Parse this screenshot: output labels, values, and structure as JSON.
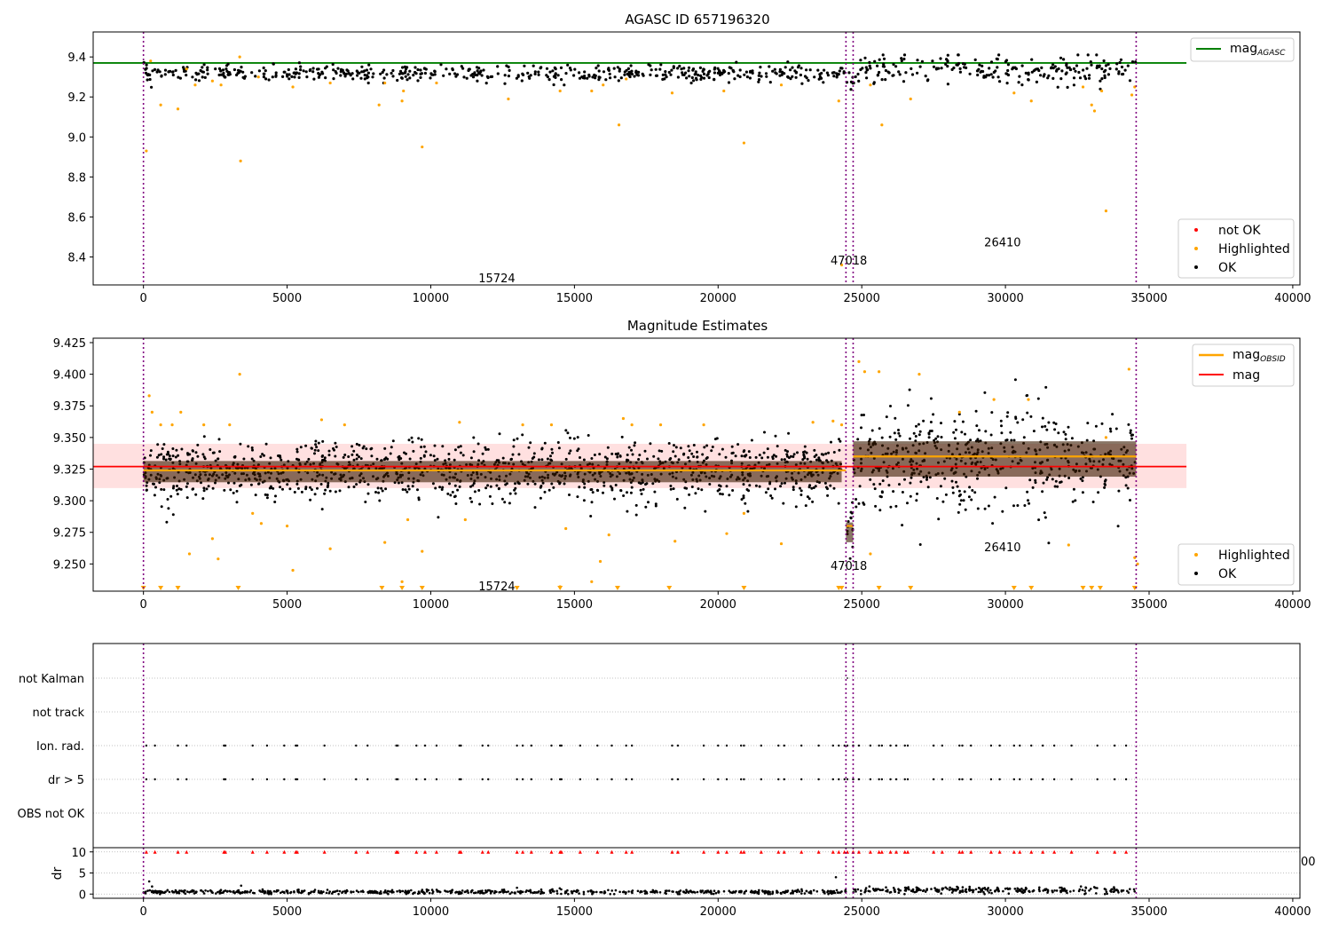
{
  "chart_data": [
    {
      "type": "scatter",
      "title": "AGASC ID 657196320",
      "xlim": [
        -1750,
        40250
      ],
      "ylim": [
        8.26,
        9.525
      ],
      "xticks": [
        0,
        5000,
        10000,
        15000,
        20000,
        25000,
        30000,
        35000,
        40000
      ],
      "xtick_labels": [
        "0",
        "5000",
        "10000",
        "15000",
        "20000",
        "25000",
        "30000",
        "35000",
        "40000"
      ],
      "yticks": [
        8.4,
        8.6,
        8.8,
        9.0,
        9.2,
        9.4
      ],
      "ytick_labels": [
        "8.4",
        "8.6",
        "8.8",
        "9.0",
        "9.2",
        "9.4"
      ],
      "vlines": [
        0,
        24450,
        24700,
        34550
      ],
      "hline": {
        "name": "mag_AGASC",
        "y": 9.37,
        "x": [
          -1750,
          36300
        ],
        "color": "#008000"
      },
      "series": [
        {
          "name": "not OK",
          "color": "#ff0000",
          "points": []
        },
        {
          "name": "Highlighted",
          "color": "#ffa500",
          "points": [
            [
              100,
              8.93
            ],
            [
              250,
              9.38
            ],
            [
              600,
              9.16
            ],
            [
              1200,
              9.14
            ],
            [
              1500,
              9.34
            ],
            [
              1800,
              9.26
            ],
            [
              2400,
              9.28
            ],
            [
              2700,
              9.26
            ],
            [
              3350,
              9.4
            ],
            [
              3380,
              8.88
            ],
            [
              4000,
              9.3
            ],
            [
              5200,
              9.25
            ],
            [
              6500,
              9.27
            ],
            [
              8200,
              9.16
            ],
            [
              8400,
              9.27
            ],
            [
              9000,
              9.18
            ],
            [
              9050,
              9.23
            ],
            [
              9700,
              8.95
            ],
            [
              10200,
              9.27
            ],
            [
              12700,
              9.19
            ],
            [
              14500,
              9.23
            ],
            [
              15600,
              9.23
            ],
            [
              16000,
              9.26
            ],
            [
              16550,
              9.06
            ],
            [
              16800,
              9.29
            ],
            [
              18400,
              9.22
            ],
            [
              20200,
              9.23
            ],
            [
              20900,
              8.97
            ],
            [
              22200,
              9.26
            ],
            [
              24200,
              9.18
            ],
            [
              24300,
              8.36
            ],
            [
              25300,
              9.26
            ],
            [
              25700,
              9.06
            ],
            [
              26700,
              9.19
            ],
            [
              30300,
              9.22
            ],
            [
              30900,
              9.18
            ],
            [
              32700,
              9.25
            ],
            [
              33000,
              9.16
            ],
            [
              33100,
              9.13
            ],
            [
              33350,
              9.23
            ],
            [
              33500,
              8.63
            ],
            [
              34400,
              9.21
            ],
            [
              34500,
              9.25
            ]
          ]
        },
        {
          "name": "OK",
          "color": "#000000",
          "segments": [
            {
              "x": [
                0,
                24250
              ],
              "mean": 9.318,
              "spread": 0.05
            },
            {
              "x": [
                24250,
                24450
              ],
              "mean": 9.33,
              "spread": 0.06
            },
            {
              "x": [
                24450,
                24700
              ],
              "mean": 9.28,
              "spread": 0.07
            },
            {
              "x": [
                24700,
                34550
              ],
              "mean": 9.335,
              "spread": 0.09
            }
          ]
        }
      ],
      "obsid_labels": [
        {
          "x": 12300,
          "y": 8.29,
          "text": "15724"
        },
        {
          "x": 24550,
          "y": 8.38,
          "text": "47018"
        },
        {
          "x": 29900,
          "y": 8.47,
          "text": "26410"
        }
      ],
      "legend_upper": {
        "placement": "upper right",
        "items": [
          "mag_AGASC"
        ]
      },
      "legend_lower": {
        "placement": "lower right",
        "items": [
          "not OK",
          "Highlighted",
          "OK"
        ]
      }
    },
    {
      "type": "scatter",
      "title": "Magnitude Estimates",
      "xlim": [
        -1750,
        40250
      ],
      "ylim": [
        9.2285,
        9.4285
      ],
      "xticks": [
        0,
        5000,
        10000,
        15000,
        20000,
        25000,
        30000,
        35000,
        40000
      ],
      "xtick_labels": [
        "0",
        "5000",
        "10000",
        "15000",
        "20000",
        "25000",
        "30000",
        "35000",
        "40000"
      ],
      "yticks": [
        9.25,
        9.275,
        9.3,
        9.325,
        9.35,
        9.375,
        9.4,
        9.425
      ],
      "ytick_labels": [
        "9.250",
        "9.275",
        "9.300",
        "9.325",
        "9.350",
        "9.375",
        "9.400",
        "9.425"
      ],
      "vlines": [
        0,
        24450,
        24700,
        34550
      ],
      "mag_line": {
        "name": "mag",
        "y": 9.327,
        "band": [
          9.31,
          9.345
        ],
        "x": [
          -1750,
          36300
        ],
        "color": "#ff0000"
      },
      "obsid_mag_segments": [
        {
          "x": [
            0,
            24450
          ],
          "y": 9.324
        },
        {
          "x": [
            24450,
            24700
          ],
          "y": 9.28
        },
        {
          "x": [
            24700,
            34550
          ],
          "y": 9.335
        }
      ],
      "series": [
        {
          "name": "Highlighted",
          "color": "#ffa500",
          "points": [
            [
              200,
              9.383
            ],
            [
              300,
              9.37
            ],
            [
              600,
              9.36
            ],
            [
              1000,
              9.36
            ],
            [
              1300,
              9.37
            ],
            [
              1600,
              9.258
            ],
            [
              2100,
              9.36
            ],
            [
              2400,
              9.27
            ],
            [
              2600,
              9.254
            ],
            [
              3000,
              9.36
            ],
            [
              3350,
              9.4
            ],
            [
              3800,
              9.29
            ],
            [
              4100,
              9.282
            ],
            [
              5000,
              9.28
            ],
            [
              5200,
              9.245
            ],
            [
              6200,
              9.364
            ],
            [
              6500,
              9.262
            ],
            [
              7000,
              9.36
            ],
            [
              8400,
              9.267
            ],
            [
              9000,
              9.236
            ],
            [
              9200,
              9.285
            ],
            [
              9700,
              9.26
            ],
            [
              11000,
              9.362
            ],
            [
              11200,
              9.285
            ],
            [
              13200,
              9.36
            ],
            [
              14200,
              9.36
            ],
            [
              14500,
              9.232
            ],
            [
              14700,
              9.278
            ],
            [
              15600,
              9.236
            ],
            [
              15900,
              9.252
            ],
            [
              16200,
              9.273
            ],
            [
              16700,
              9.365
            ],
            [
              17000,
              9.36
            ],
            [
              18000,
              9.36
            ],
            [
              18500,
              9.268
            ],
            [
              19500,
              9.36
            ],
            [
              20300,
              9.274
            ],
            [
              20900,
              9.29
            ],
            [
              22200,
              9.266
            ],
            [
              23300,
              9.362
            ],
            [
              24000,
              9.363
            ],
            [
              24300,
              9.36
            ],
            [
              24900,
              9.41
            ],
            [
              25100,
              9.402
            ],
            [
              25300,
              9.258
            ],
            [
              25600,
              9.402
            ],
            [
              27000,
              9.4
            ],
            [
              28400,
              9.37
            ],
            [
              29600,
              9.38
            ],
            [
              30800,
              9.38
            ],
            [
              32200,
              9.265
            ],
            [
              33500,
              9.35
            ],
            [
              34300,
              9.404
            ],
            [
              34500,
              9.255
            ],
            [
              34600,
              9.25
            ]
          ]
        },
        {
          "name": "OK",
          "color": "#000000",
          "segments": [
            {
              "x": [
                0,
                24300
              ],
              "mean": 9.323,
              "spread": 0.03
            },
            {
              "x": [
                24450,
                24700
              ],
              "mean": 9.275,
              "spread": 0.028
            },
            {
              "x": [
                24700,
                34550
              ],
              "mean": 9.333,
              "spread": 0.05
            }
          ]
        }
      ],
      "offscale_markers_x": [
        0,
        600,
        1200,
        3300,
        8300,
        9000,
        9700,
        13000,
        14500,
        16500,
        18300,
        20900,
        24200,
        24300,
        25600,
        26700,
        30300,
        30900,
        32700,
        33000,
        33300,
        34500
      ],
      "obsid_labels": [
        {
          "x": 12300,
          "y": 9.232,
          "text": "15724"
        },
        {
          "x": 24550,
          "y": 9.248,
          "text": "47018"
        },
        {
          "x": 29900,
          "y": 9.263,
          "text": "26410"
        }
      ],
      "legend_upper": {
        "placement": "upper right",
        "items": [
          "mag_OBSID",
          "mag"
        ]
      },
      "legend_lower": {
        "placement": "lower right",
        "items": [
          "Highlighted",
          "OK"
        ]
      }
    },
    {
      "type": "scatter",
      "categories": [
        "not Kalman",
        "not track",
        "Ion. rad.",
        "dr > 5",
        "OBS not OK"
      ],
      "xlim": [
        -1750,
        40250
      ],
      "vlines": [
        0,
        24450,
        24700,
        34550
      ],
      "flag_x_positions": [
        100,
        400,
        1200,
        1500,
        2800,
        2850,
        3800,
        4300,
        4900,
        5300,
        5350,
        6300,
        7400,
        7800,
        8800,
        8850,
        9500,
        9800,
        10200,
        11000,
        11050,
        11800,
        12000,
        13000,
        13200,
        13500,
        14200,
        14500,
        14550,
        15200,
        15800,
        16300,
        16800,
        17000,
        18400,
        18600,
        19500,
        20000,
        20300,
        20800,
        20900,
        21500,
        22100,
        22300,
        22900,
        23500,
        24000,
        24200,
        24400,
        24500,
        24700,
        24900,
        25300,
        25600,
        25700,
        26000,
        26200,
        26500,
        26600,
        27500,
        27800,
        28400,
        28500,
        28800,
        29500,
        29800,
        30300,
        30500,
        30900,
        31300,
        31700,
        32300,
        33200,
        33800,
        34200
      ],
      "not_kalman_x": [
        24500
      ]
    },
    {
      "type": "scatter",
      "ylabel": "dr",
      "xlim": [
        -1750,
        40250
      ],
      "ylim": [
        -1,
        11
      ],
      "yticks": [
        0,
        5,
        10
      ],
      "ytick_labels": [
        "0",
        "5",
        "10"
      ],
      "xticks": [
        0,
        5000,
        10000,
        15000,
        20000,
        25000,
        30000,
        35000,
        40000
      ],
      "xtick_labels": [
        "0",
        "5000",
        "10000",
        "15000",
        "20000",
        "25000",
        "30000",
        "35000",
        "40000"
      ],
      "vlines": [
        0,
        24450,
        24700,
        34550
      ],
      "segments": [
        {
          "x": [
            0,
            24450
          ],
          "mean": 0.5,
          "spread": 0.6
        },
        {
          "x": [
            24700,
            34550
          ],
          "mean": 0.9,
          "spread": 1.0
        }
      ],
      "outliers": [
        [
          200,
          3.0
        ],
        [
          300,
          1.8
        ],
        [
          3400,
          2.0
        ],
        [
          13000,
          1.5
        ],
        [
          24100,
          4.0
        ]
      ],
      "capped_value": 10,
      "partial_label": "00"
    }
  ]
}
